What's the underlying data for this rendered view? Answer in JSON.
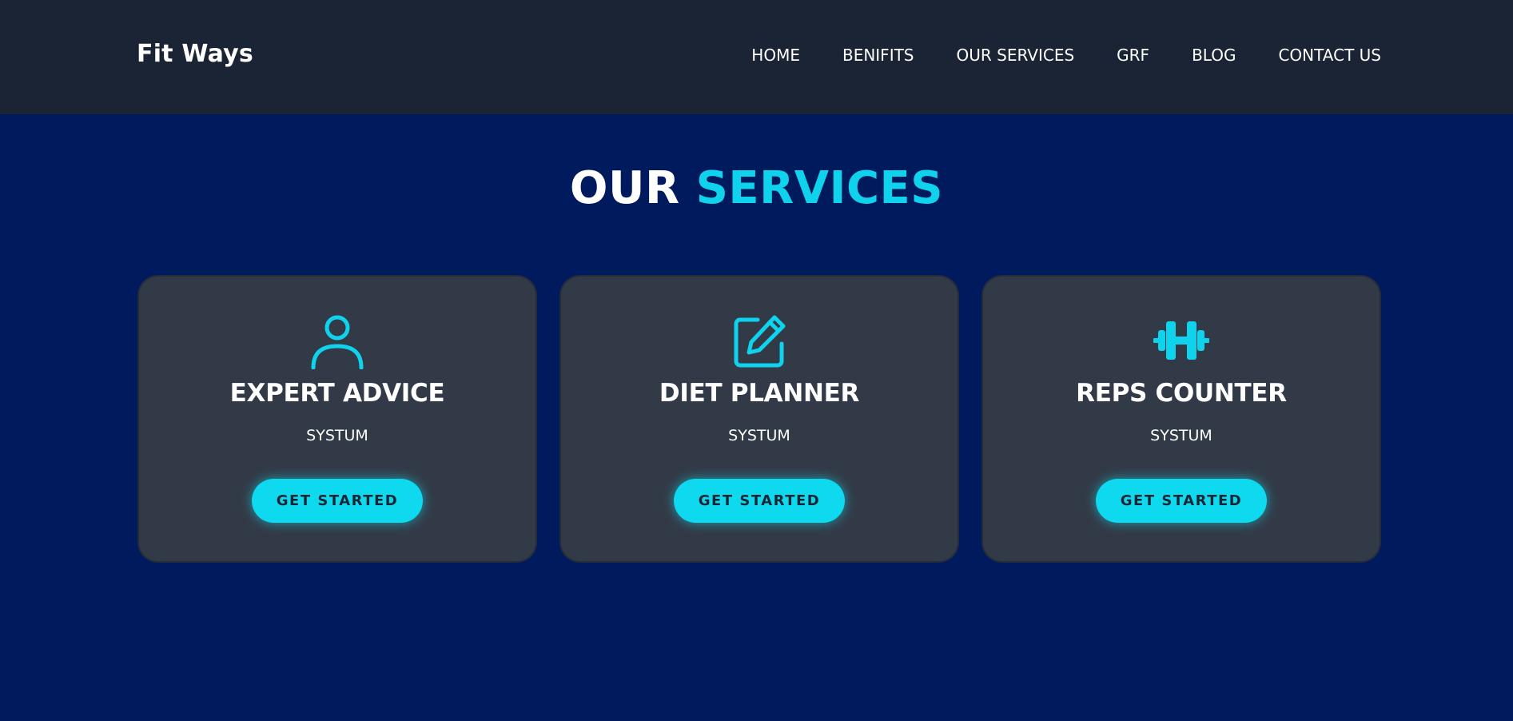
{
  "header": {
    "brand": "Fit Ways",
    "nav": [
      {
        "label": "HOME"
      },
      {
        "label": "BENIFITS"
      },
      {
        "label": "OUR SERVICES"
      },
      {
        "label": "GRF"
      },
      {
        "label": "BLOG"
      },
      {
        "label": "CONTACT US"
      }
    ]
  },
  "services": {
    "title_main": "OUR",
    "title_accent": "SERVICES",
    "cards": [
      {
        "icon": "user-icon",
        "title": "EXPERT ADVICE",
        "subtitle": "SYSTUM",
        "button": "GET STARTED"
      },
      {
        "icon": "edit-icon",
        "title": "DIET PLANNER",
        "subtitle": "SYSTUM",
        "button": "GET STARTED"
      },
      {
        "icon": "dumbbell-icon",
        "title": "REPS COUNTER",
        "subtitle": "SYSTUM",
        "button": "GET STARTED"
      }
    ]
  },
  "colors": {
    "page_bg": "#001a5e",
    "navbar_bg": "#1a2434",
    "card_bg": "#333a47",
    "accent": "#0fd3ec",
    "button_text": "#1b2633"
  }
}
